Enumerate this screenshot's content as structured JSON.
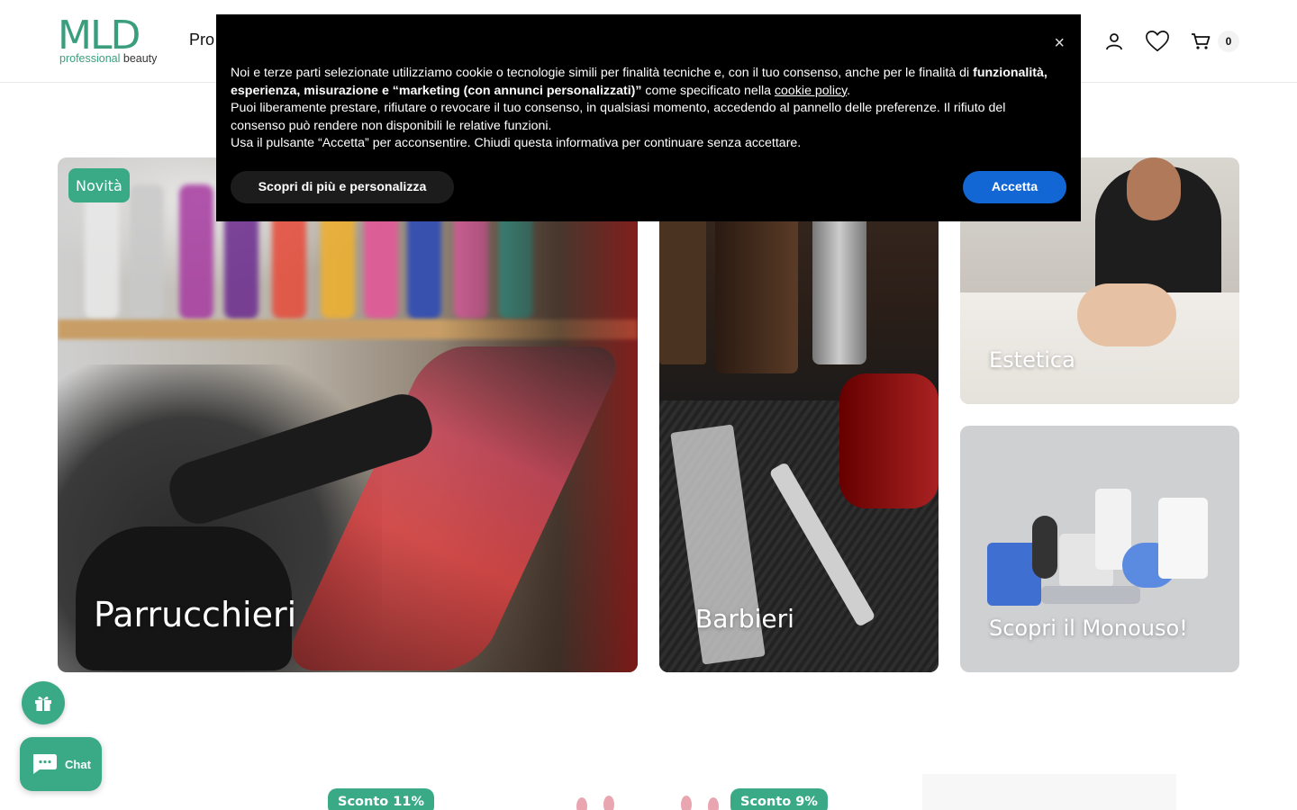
{
  "header": {
    "logo_mark": "MLD",
    "logo_sub_a": "professional",
    "logo_sub_b": " beauty",
    "nav_first": "Pro",
    "cart_count": "0"
  },
  "cookie": {
    "close": "×",
    "t1": "Noi e terze parti selezionate utilizziamo cookie o tecnologie simili per finalità tecniche e, con il tuo consenso, anche per le finalità di ",
    "t1_bold": "funzionalità, esperienza, misurazione e “marketing (con annunci personalizzati)”",
    "t1_rest": " come specificato nella ",
    "t1_link": "cookie policy",
    "t1_end": ".",
    "t2": "Puoi liberamente prestare, rifiutare o revocare il tuo consenso, in qualsiasi momento, accedendo al pannello delle preferenze. Il rifiuto del consenso può rendere non disponibili le relative funzioni.",
    "t3": "Usa il pulsante “Accetta” per acconsentire. Chiudi questa informativa per continuare senza accettare.",
    "btn_more": "Scopri di più e personalizza",
    "btn_accept": "Accetta"
  },
  "tiles": {
    "badge": "Novità",
    "parrucchieri": "Parrucchieri",
    "barbieri": "Barbieri",
    "estetica": "Estetica",
    "monouso": "Scopri il Monouso!"
  },
  "floating": {
    "chat": "Chat"
  },
  "discounts": {
    "d1": "Sconto 11%",
    "d2": "Sconto 9%"
  },
  "colors": {
    "brand": "#3aaa86",
    "accept": "#1267d4",
    "banner_bg": "#000000"
  }
}
